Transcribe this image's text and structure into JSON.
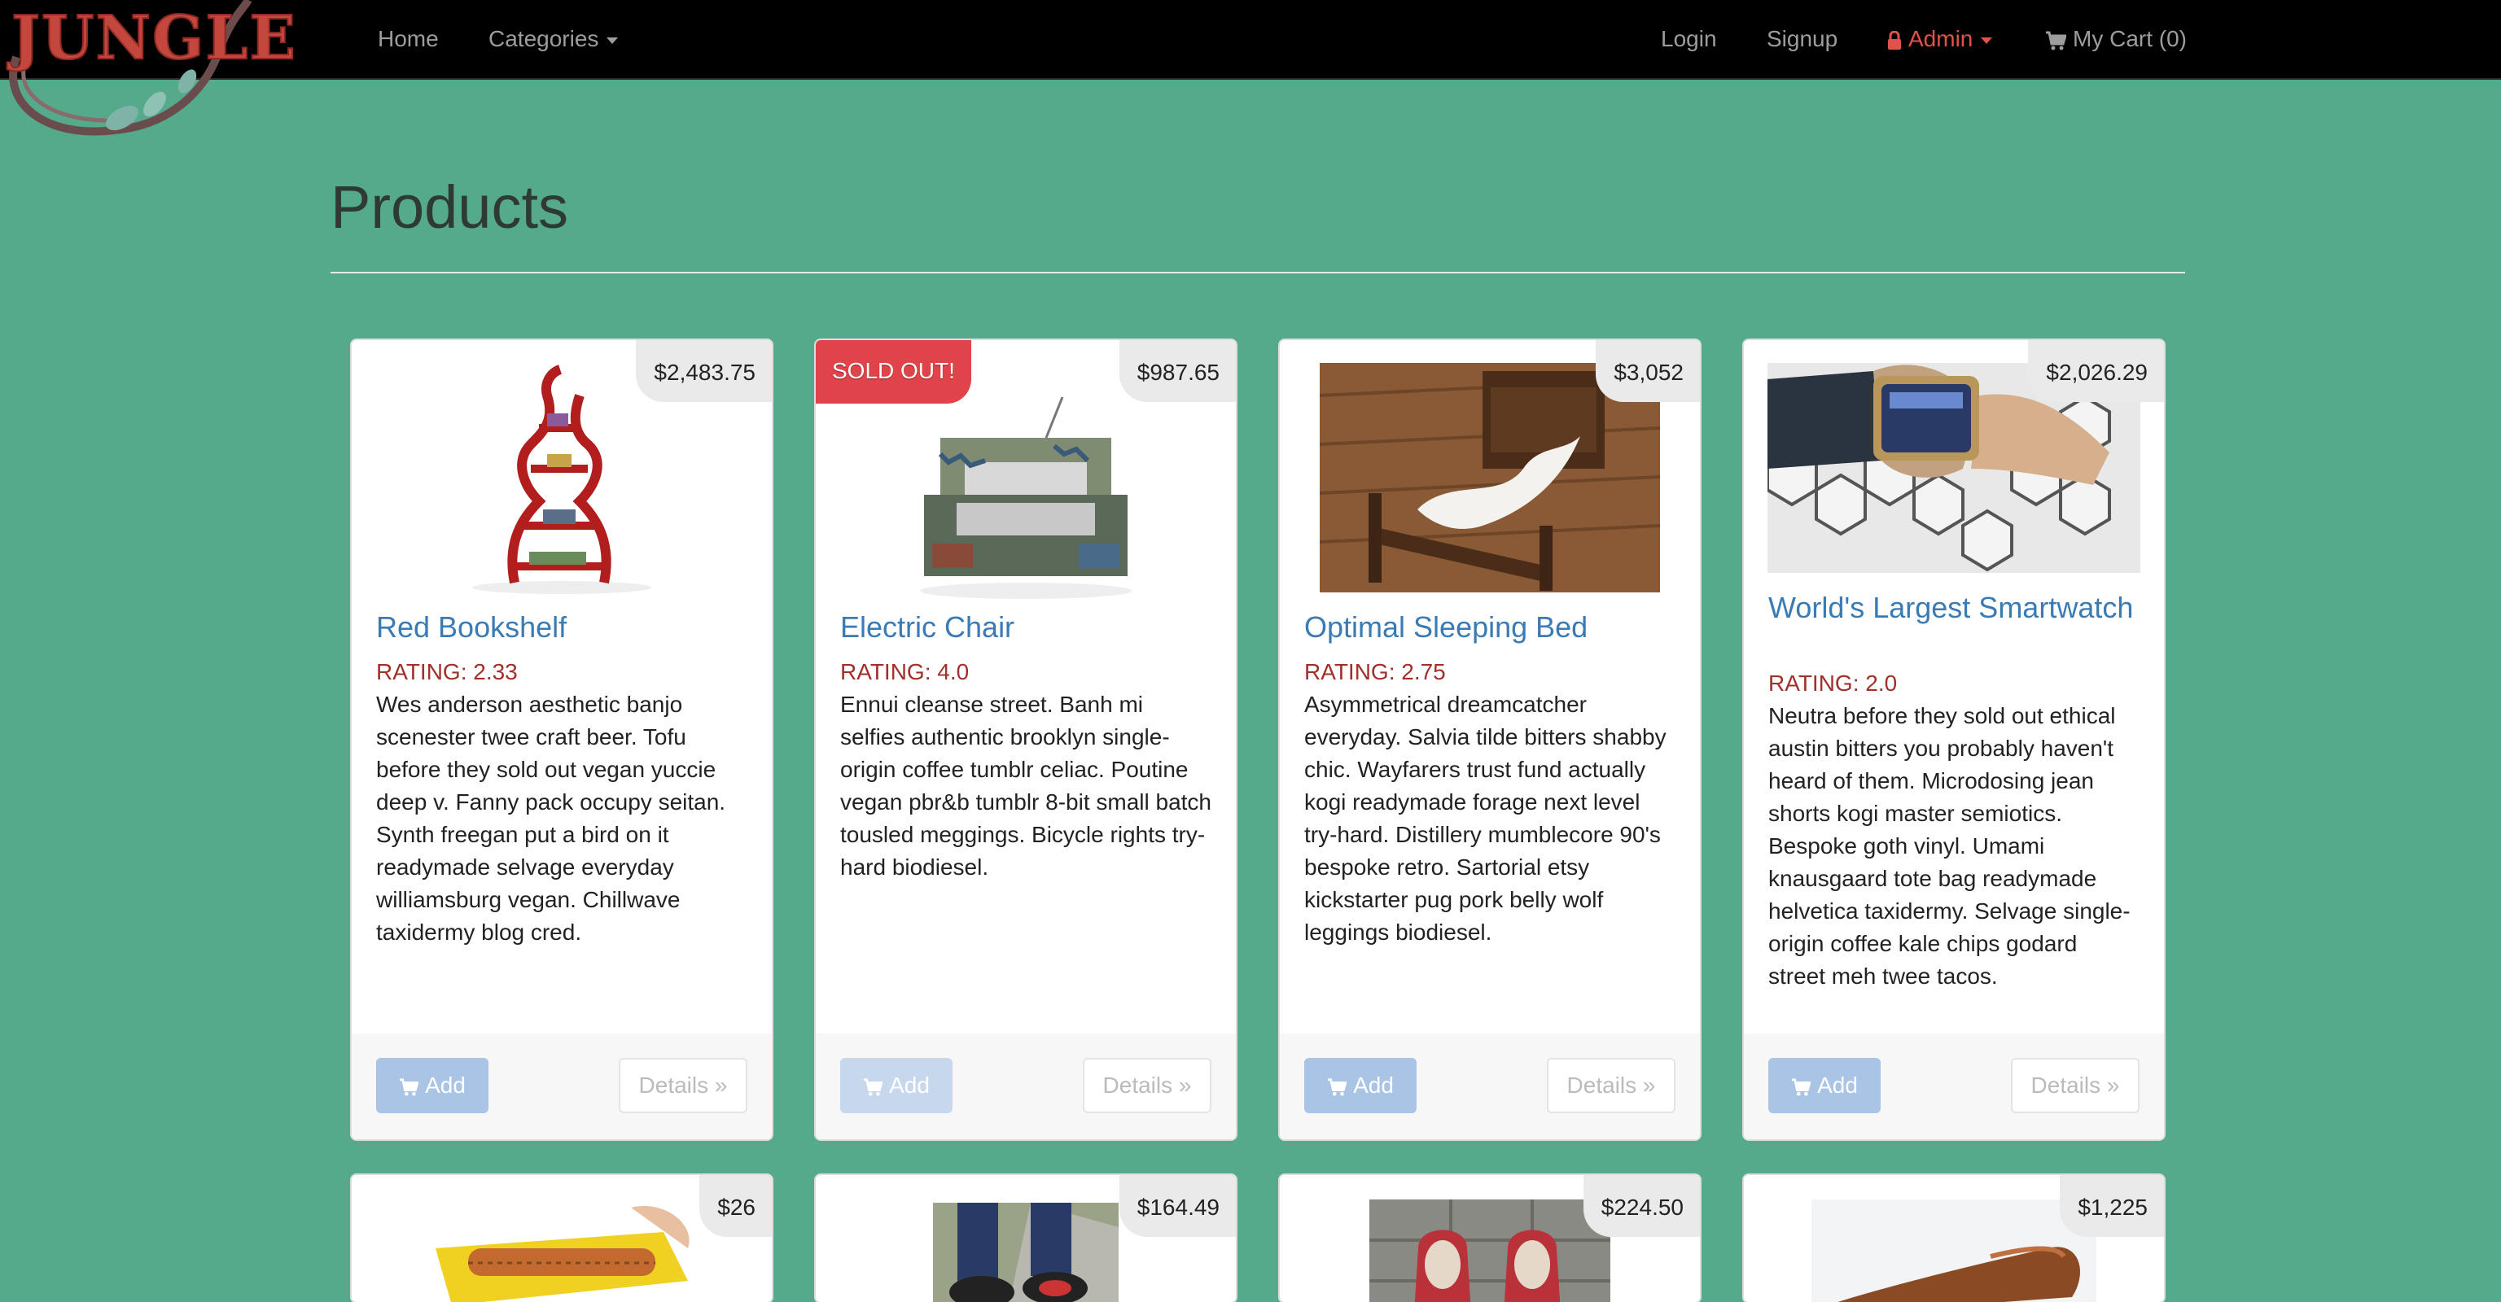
{
  "logo": {
    "text": "JUNGLE"
  },
  "nav": {
    "home": "Home",
    "categories": "Categories",
    "login": "Login",
    "signup": "Signup",
    "admin": "Admin",
    "cart": "My Cart (0)"
  },
  "page": {
    "title": "Products"
  },
  "buttons": {
    "add": "Add",
    "details": "Details »"
  },
  "products": [
    {
      "name": "Red Bookshelf",
      "price": "$2,483.75",
      "rating": "RATING: 2.33",
      "description": "Wes anderson aesthetic banjo scenester twee craft beer. Tofu before they sold out vegan yuccie deep v. Fanny pack occupy seitan. Synth freegan put a bird on it readymade selvage everyday williamsburg vegan. Chillwave taxidermy blog cred.",
      "sold_out": false
    },
    {
      "name": "Electric Chair",
      "price": "$987.65",
      "rating": "RATING: 4.0",
      "description": "Ennui cleanse street. Banh mi selfies authentic brooklyn single-origin coffee tumblr celiac. Poutine vegan pbr&b tumblr 8-bit small batch tousled meggings. Bicycle rights try-hard biodiesel.",
      "sold_out": true,
      "sold_out_label": "SOLD OUT!"
    },
    {
      "name": "Optimal Sleeping Bed",
      "price": "$3,052",
      "rating": "RATING: 2.75",
      "description": "Asymmetrical dreamcatcher everyday. Salvia tilde bitters shabby chic. Wayfarers trust fund actually kogi readymade forage next level try-hard. Distillery mumblecore 90's bespoke retro. Sartorial etsy kickstarter pug pork belly wolf leggings biodiesel.",
      "sold_out": false
    },
    {
      "name": "World's Largest Smartwatch",
      "price": "$2,026.29",
      "rating": "RATING: 2.0",
      "description": "Neutra before they sold out ethical austin bitters you probably haven't heard of them. Microdosing jean shorts kogi master semiotics. Bespoke goth vinyl. Umami knausgaard tote bag readymade helvetica taxidermy. Selvage single-origin coffee kale chips godard street meh twee tacos.",
      "sold_out": false
    },
    {
      "price": "$26"
    },
    {
      "price": "$164.49"
    },
    {
      "price": "$224.50"
    },
    {
      "price": "$1,225"
    }
  ]
}
